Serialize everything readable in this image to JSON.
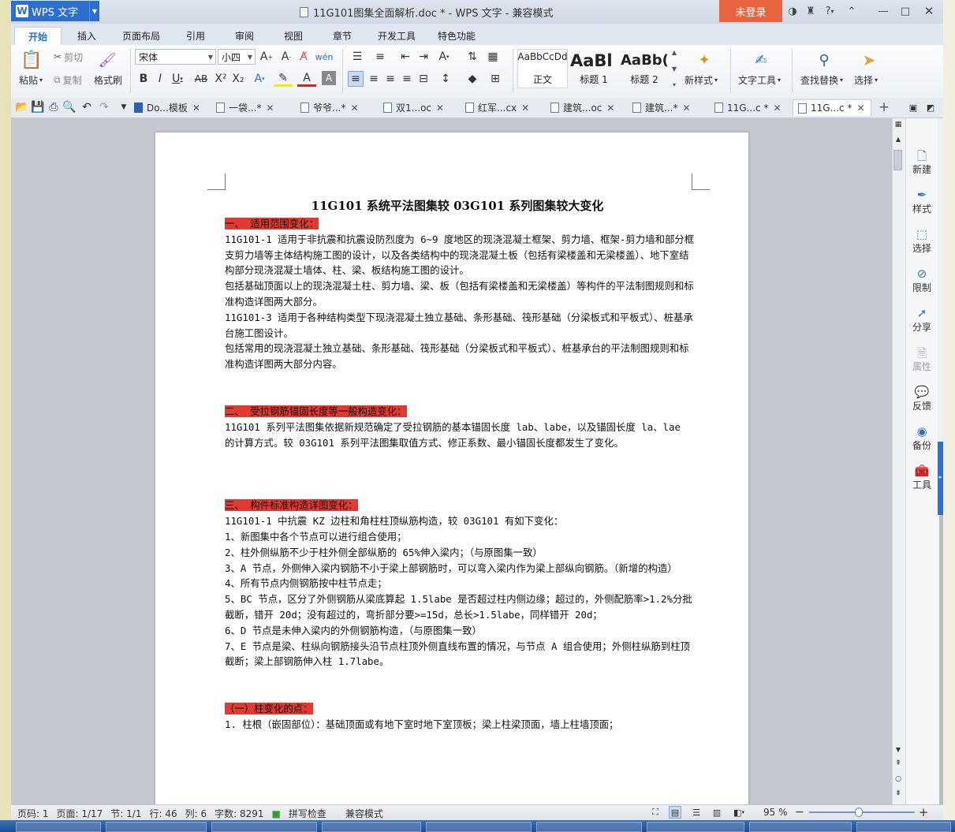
{
  "app": {
    "name": "WPS 文字",
    "window_title": "11G101图集全面解析.doc * - WPS 文字 - 兼容模式",
    "login": "未登录",
    "help": "?"
  },
  "menu_tabs": [
    "开始",
    "插入",
    "页面布局",
    "引用",
    "审阅",
    "视图",
    "章节",
    "开发工具",
    "特色功能"
  ],
  "ribbon": {
    "paste": "粘贴",
    "cut": "剪切",
    "copy": "复制",
    "format_painter": "格式刷",
    "font_name": "宋体",
    "font_size": "小四",
    "styles": [
      {
        "preview": "AaBbCcDd",
        "name": "正文"
      },
      {
        "preview": "AaBl",
        "name": "标题 1"
      },
      {
        "preview": "AaBb(",
        "name": "标题 2"
      }
    ],
    "new_style": "新样式",
    "text_tools": "文字工具",
    "find_replace": "查找替换",
    "select": "选择"
  },
  "doc_tabs": [
    "Do...模板",
    "一袋...*",
    "爷爷...*",
    "双1...oc",
    "红军...cx",
    "建筑...oc",
    "建筑...*",
    "11G...c *",
    "11G...c *"
  ],
  "document": {
    "title": "11G101 系统平法图集较 03G101 系列图集较大变化",
    "s1_heading": "一、 适用范围变化：",
    "s1_p1": "11G101-1 适用于非抗震和抗震设防烈度为 6~9 度地区的现浇混凝土框架、剪力墙、框架-剪力墙和部分框支剪力墙等主体结构施工图的设计，以及各类结构中的现浇混凝土板（包括有梁楼盖和无梁楼盖）、地下室结构部分现浇混凝土墙体、柱、梁、板结构施工图的设计。",
    "s1_p2": "包括基础顶面以上的现浇混凝土柱、剪力墙、梁、板（包括有梁楼盖和无梁楼盖）等构件的平法制图规则和标准构造详图两大部分。",
    "s1_p3": "11G101-3 适用于各种结构类型下现浇混凝土独立基础、条形基础、筏形基础（分梁板式和平板式）、桩基承台施工图设计。",
    "s1_p4": "包括常用的现浇混凝土独立基础、条形基础、筏形基础（分梁板式和平板式）、桩基承台的平法制图规则和标准构造详图两大部分内容。",
    "s2_heading": "二、 受拉钢筋锚固长度等一般构造变化：",
    "s2_p1": "11G101 系列平法图集依据新规范确定了受拉钢筋的基本锚固长度 lab、labe，以及锚固长度 la、lae 的计算方式。较 03G101 系列平法图集取值方式、修正系数、最小锚固长度都发生了变化。",
    "s3_heading": "三、 构件标准构造详图变化：",
    "s3_intro": "11G101-1 中抗震 KZ 边柱和角柱柱顶纵筋构造，较 03G101 有如下变化：",
    "s3_items": [
      "1、新图集中各个节点可以进行组合使用；",
      "2、柱外侧纵筋不少于柱外侧全部纵筋的 65%伸入梁内；（与原图集一致）",
      "3、A 节点，外侧伸入梁内钢筋不小于梁上部钢筋时，可以弯入梁内作为梁上部纵向钢筋。（新增的构造）",
      "4、所有节点内侧钢筋按中柱节点走；",
      "5、BC 节点，区分了外侧钢筋从梁底算起 1.5labe 是否超过柱内侧边缘；超过的，外侧配筋率>1.2%分批截断，错开 20d；没有超过的，弯折部分要>=15d，总长>1.5labe，同样错开 20d；",
      "6、D 节点是未伸入梁内的外侧钢筋构造，（与原图集一致）",
      "7、E 节点是梁、柱纵向钢筋接头沿节点柱顶外侧直线布置的情况，与节点 A 组合使用；外侧柱纵筋到柱顶截断；梁上部钢筋伸入柱 1.7labe。"
    ],
    "s4_heading": "（一）柱变化的点：",
    "s4_p1": "1. 柱根（嵌固部位）：基础顶面或有地下室时地下室顶板；梁上柱梁顶面，墙上柱墙顶面；"
  },
  "right_panel": [
    {
      "icon": "new-doc-icon",
      "label": "新建",
      "enabled": true
    },
    {
      "icon": "style-icon",
      "label": "样式",
      "enabled": true
    },
    {
      "icon": "select-icon",
      "label": "选择",
      "enabled": true
    },
    {
      "icon": "restrict-icon",
      "label": "限制",
      "enabled": true
    },
    {
      "icon": "share-icon",
      "label": "分享",
      "enabled": true
    },
    {
      "icon": "property-icon",
      "label": "属性",
      "enabled": false
    },
    {
      "icon": "feedback-icon",
      "label": "反馈",
      "enabled": true
    },
    {
      "icon": "backup-icon",
      "label": "备份",
      "enabled": true
    },
    {
      "icon": "toolbox-icon",
      "label": "工具",
      "enabled": true
    }
  ],
  "status": {
    "page_code": "页码: 1",
    "pages": "页面: 1/17",
    "section": "节: 1/1",
    "row": "行: 46",
    "col": "列: 6",
    "words": "字数: 8291",
    "spell": "拼写检查",
    "compat": "兼容模式",
    "zoom": "95 %"
  },
  "zoom_level_percent": 95
}
